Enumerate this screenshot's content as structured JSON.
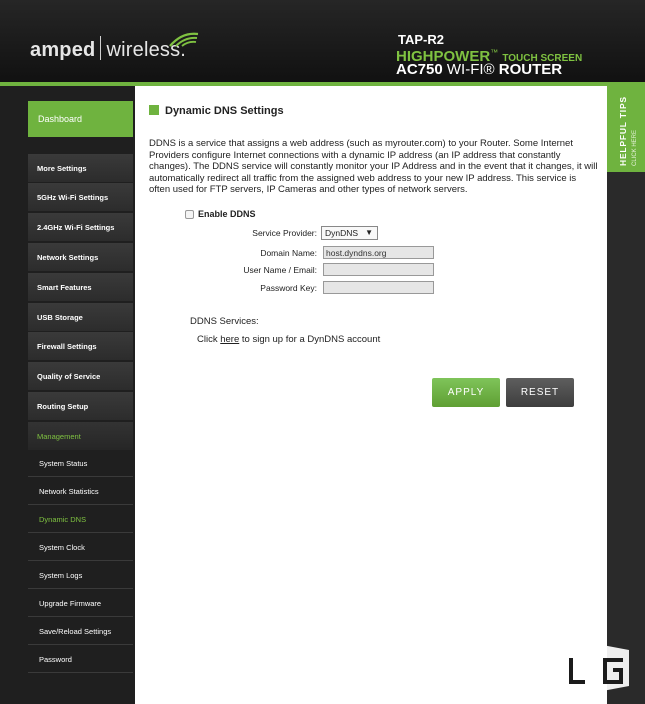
{
  "header": {
    "logo_brand": "amped",
    "logo_word": "wireless.",
    "model": "TAP-R2",
    "tagline_high": "HIGHPOWER",
    "tagline_tm": "™",
    "tagline_touch": "TOUCH SCREEN",
    "tagline_ac": "AC750",
    "tagline_wifi": "WI-FI®",
    "tagline_router": "ROUTER"
  },
  "sidebar": {
    "dashboard": "Dashboard",
    "more_settings": "More Settings",
    "items": [
      "5GHz Wi-Fi Settings",
      "2.4GHz Wi-Fi Settings",
      "Network Settings",
      "Smart Features",
      "USB Storage",
      "Firewall Settings",
      "Quality of Service",
      "Routing Setup"
    ],
    "management": "Management",
    "sub_items": [
      "System Status",
      "Network Statistics",
      "Dynamic DNS",
      "System Clock",
      "System Logs",
      "Upgrade Firmware",
      "Save/Reload Settings",
      "Password"
    ],
    "active_sub": "Dynamic DNS"
  },
  "main": {
    "title": "Dynamic DNS Settings",
    "description": "DDNS is a service that assigns a web address (such as myrouter.com) to your Router. Some Internet Providers configure Internet connections with a dynamic IP address (an IP address that constantly changes). The DDNS service will constantly monitor your IP Address and in the event that it changes, it will automatically redirect all traffic from the assigned web address to your new IP address. This service is often used for FTP servers, IP Cameras and other types of network servers.",
    "enable_label": "Enable DDNS",
    "form": {
      "provider_label": "Service Provider:",
      "provider_value": "DynDNS",
      "domain_label": "Domain Name:",
      "domain_value": "host.dyndns.org",
      "user_label": "User Name / Email:",
      "user_value": "",
      "key_label": "Password Key:",
      "key_value": ""
    },
    "services_title": "DDNS Services:",
    "services_pre": "Click",
    "services_link": "here",
    "services_post": "to sign up for a DynDNS account",
    "apply": "APPLY",
    "reset": "RESET"
  },
  "tips": {
    "title": "HELPFUL TIPS",
    "sub": "CLICK HERE"
  },
  "colors": {
    "accent": "#6fb33f",
    "header_bg": "#1c1c1c",
    "sidebar_bg": "#1f1f1f"
  }
}
